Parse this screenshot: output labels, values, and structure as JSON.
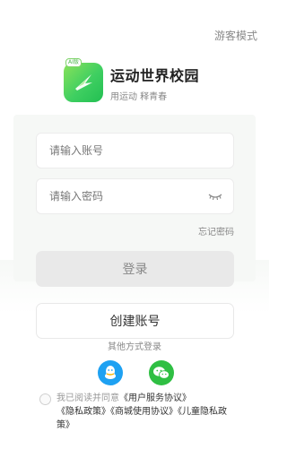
{
  "header": {
    "guest_mode": "游客模式"
  },
  "brand": {
    "tag": "AI版",
    "title": "运动世界校园",
    "slogan": "用运动 释青春"
  },
  "form": {
    "account_placeholder": "请输入账号",
    "password_placeholder": "请输入密码",
    "forgot_password": "忘记密码",
    "login_label": "登录",
    "create_account_label": "创建账号"
  },
  "social": {
    "other_methods": "其他方式登录",
    "icons": [
      "qq-icon",
      "wechat-icon"
    ]
  },
  "agreement": {
    "prefix": "我已阅读并同意",
    "links": [
      "《用户服务协议》",
      "《隐私政策》",
      "《商城使用协议》",
      "《儿童隐私政策》"
    ]
  },
  "colors": {
    "brand_green": "#3fcf61",
    "qq_blue": "#1ea1f2",
    "wechat_green": "#2fbf43",
    "login_disabled_bg": "#e9e9e9"
  }
}
